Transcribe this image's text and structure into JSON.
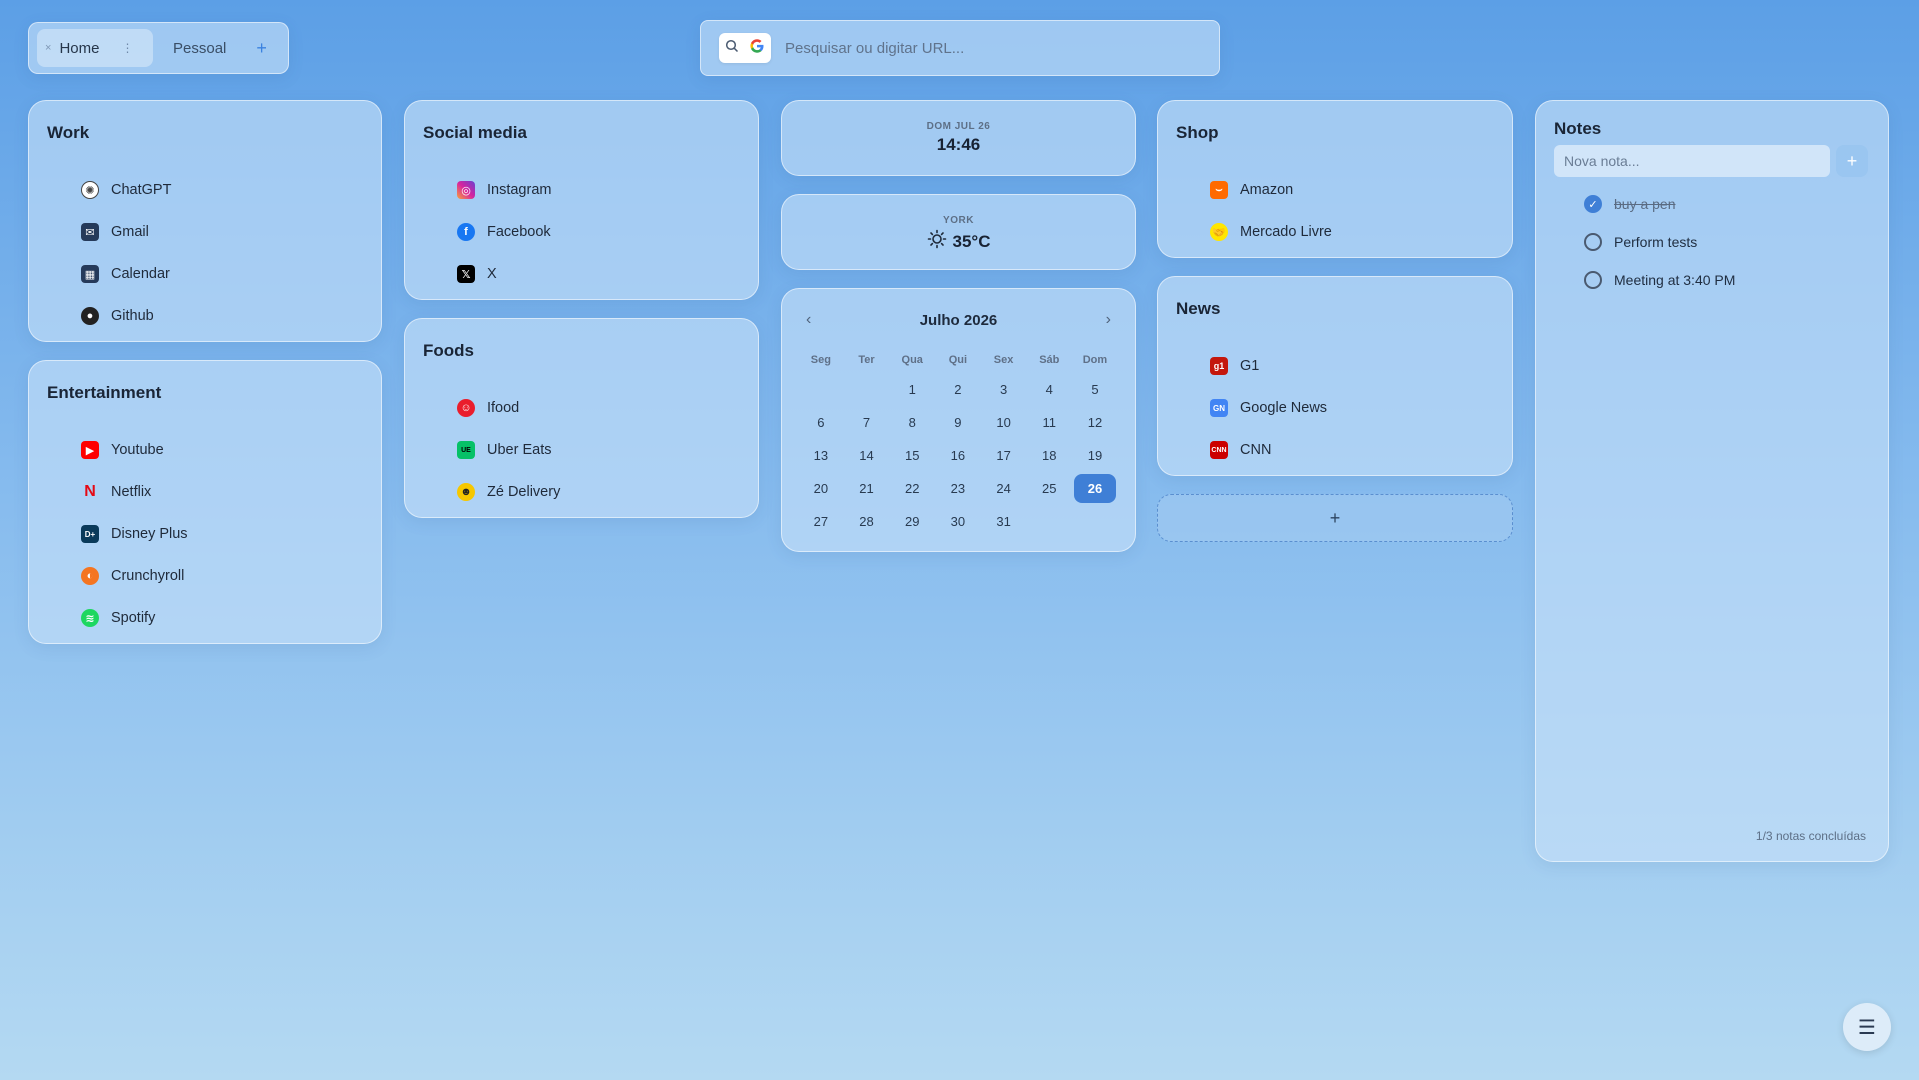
{
  "tabs": {
    "items": [
      {
        "label": "Home"
      },
      {
        "label": "Pessoal"
      }
    ],
    "close_glyph": "×",
    "options_glyph": "⋮",
    "add_glyph": "+"
  },
  "search": {
    "placeholder": "Pesquisar ou digitar URL..."
  },
  "groups": {
    "work": {
      "title": "Work",
      "links": [
        {
          "label": "ChatGPT",
          "icon": "chatgpt-icon",
          "color": "#444444"
        },
        {
          "label": "Gmail",
          "icon": "gmail-icon",
          "color": "#253a5a"
        },
        {
          "label": "Calendar",
          "icon": "calendar-icon",
          "color": "#253a5a"
        },
        {
          "label": "Github",
          "icon": "github-icon",
          "color": "#222222"
        }
      ]
    },
    "social": {
      "title": "Social media",
      "links": [
        {
          "label": "Instagram",
          "icon": "instagram-icon",
          "color": "#d6249f"
        },
        {
          "label": "Facebook",
          "icon": "facebook-icon",
          "color": "#1877f2"
        },
        {
          "label": "X",
          "icon": "x-icon",
          "color": "#000000"
        }
      ]
    },
    "foods": {
      "title": "Foods",
      "links": [
        {
          "label": "Ifood",
          "icon": "ifood-icon",
          "color": "#ea1d2c"
        },
        {
          "label": "Uber Eats",
          "icon": "uber-eats-icon",
          "color": "#06c167"
        },
        {
          "label": "Zé Delivery",
          "icon": "ze-delivery-icon",
          "color": "#f6c700"
        }
      ]
    },
    "entertainment": {
      "title": "Entertainment",
      "links": [
        {
          "label": "Youtube",
          "icon": "youtube-icon",
          "color": "#ff0000"
        },
        {
          "label": "Netflix",
          "icon": "netflix-icon",
          "color": "#e50914"
        },
        {
          "label": "Disney Plus",
          "icon": "disney-plus-icon",
          "color": "#0a3a5a"
        },
        {
          "label": "Crunchyroll",
          "icon": "crunchyroll-icon",
          "color": "#f47521"
        },
        {
          "label": "Spotify",
          "icon": "spotify-icon",
          "color": "#1ed760"
        }
      ]
    },
    "shop": {
      "title": "Shop",
      "links": [
        {
          "label": "Amazon",
          "icon": "amazon-icon",
          "color": "#ff6a00"
        },
        {
          "label": "Mercado Livre",
          "icon": "mercado-livre-icon",
          "color": "#ffe600"
        }
      ]
    },
    "news": {
      "title": "News",
      "links": [
        {
          "label": "G1",
          "icon": "g1-icon",
          "color": "#c4170c"
        },
        {
          "label": "Google News",
          "icon": "google-news-icon",
          "color": "#4285f4"
        },
        {
          "label": "CNN",
          "icon": "cnn-icon",
          "color": "#cc0000"
        }
      ]
    }
  },
  "clock": {
    "date": "DOM JUL 26",
    "time": "14:46"
  },
  "weather": {
    "city": "YORK",
    "temp": "35°C",
    "icon": "sun-icon"
  },
  "calendar": {
    "title": "Julho 2026",
    "weekdays": [
      "Seg",
      "Ter",
      "Qua",
      "Qui",
      "Sex",
      "Sáb",
      "Dom"
    ],
    "leading_blanks": 2,
    "days": 31,
    "today": 26
  },
  "add_group": {
    "label": "+"
  },
  "notes": {
    "title": "Notes",
    "placeholder": "Nova nota...",
    "add_label": "+",
    "items": [
      {
        "text": "buy a pen",
        "done": true
      },
      {
        "text": "Perform tests",
        "done": false
      },
      {
        "text": "Meeting at 3:40 PM",
        "done": false
      }
    ],
    "footer": "1/3 notas concluídas"
  },
  "menu": {
    "label": "☰"
  },
  "colors": {
    "accent": "#3f7fd6"
  }
}
